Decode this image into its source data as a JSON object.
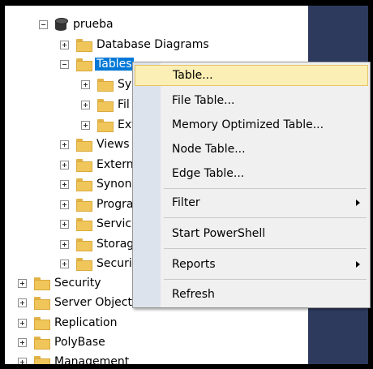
{
  "tree": {
    "database": "prueba",
    "database_diagrams": "Database Diagrams",
    "tables": "Tables",
    "tables_children": [
      "Sy",
      "Fil",
      "Ext"
    ],
    "db_children": [
      "Views",
      "Extern",
      "Synon",
      "Progra",
      "Servic",
      "Storag",
      "Securi"
    ],
    "top_level": [
      "Security",
      "Server Object",
      "Replication",
      "PolyBase",
      "Management"
    ]
  },
  "context_menu": {
    "items": {
      "table": "Table...",
      "file_table": "File Table...",
      "memory_optimized": "Memory Optimized Table...",
      "node_table": "Node Table...",
      "edge_table": "Edge Table...",
      "filter": "Filter",
      "start_powershell": "Start PowerShell",
      "reports": "Reports",
      "refresh": "Refresh"
    },
    "highlighted": "table"
  },
  "colors": {
    "selection": "#0078d7",
    "menu_highlight": "#fcefb5",
    "right_panel": "#2d3a5e"
  }
}
